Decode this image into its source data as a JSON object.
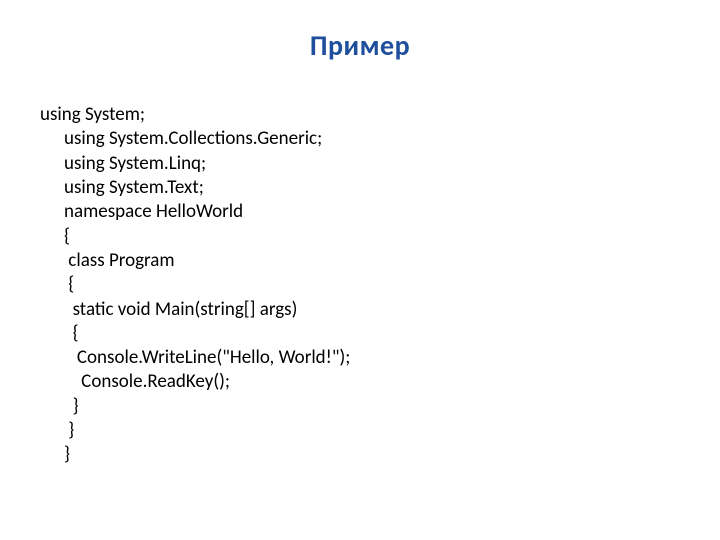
{
  "title": "Пример",
  "code": {
    "l1": "using System;",
    "l2": "using System.Collections.Generic;",
    "l3": "using System.Linq;",
    "l4": "using System.Text;",
    "l5": "",
    "l6": "namespace HelloWorld",
    "l7": "{",
    "l8": " class Program",
    "l9": " {",
    "l10": "  static void Main(string[] args)",
    "l11": "  {",
    "l12": "   Console.WriteLine(\"Hello, World!\");",
    "l13": "    Console.ReadKey();",
    "l14": "  }",
    "l15": " }",
    "l16": "}"
  }
}
